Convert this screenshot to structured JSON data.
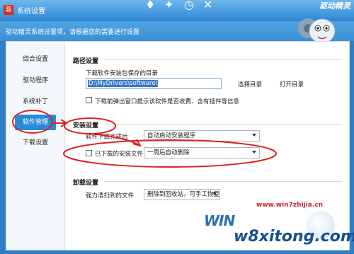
{
  "window": {
    "title": "系统设置",
    "app_icon": "驱",
    "header_hint": "驱动精灵系统设置项，请根据您的需要进行设置",
    "brand_badge": "驱动精灵"
  },
  "sidebar": {
    "items": [
      {
        "label": "综合设置"
      },
      {
        "label": "驱动程序"
      },
      {
        "label": "系统补丁"
      },
      {
        "label": "软件管理"
      },
      {
        "label": "下载设置"
      }
    ],
    "active_index": 3
  },
  "path_section": {
    "title": "路径设置",
    "dir_label": "下载软件安装包保存的目录",
    "dir_value": "D:\\MyDrivers\\software\\",
    "choose_dir": "选择目录",
    "open_dir": "打开目录",
    "popup_check_label": "下载前弹出窗口提示该软件是否收费、含有插件等信息"
  },
  "install_section": {
    "title": "安装设置",
    "after_download_label": "软件下载完成后",
    "after_download_value": "自动启动安装程序",
    "downloaded_files_label": "已下载的安装文件",
    "downloaded_files_value": "一周后自动删除"
  },
  "uninstall_section": {
    "title": "卸载设置",
    "force_clean_label": "强力清扫到的文件",
    "force_clean_value": "删除到回收站，可手工恢复"
  },
  "watermark": {
    "site": "www.win7zhijia.cn",
    "win": "WIN",
    "brand": "w8xitong.com"
  },
  "colors": {
    "accent": "#2b8ad6",
    "annotation": "#e02020"
  }
}
